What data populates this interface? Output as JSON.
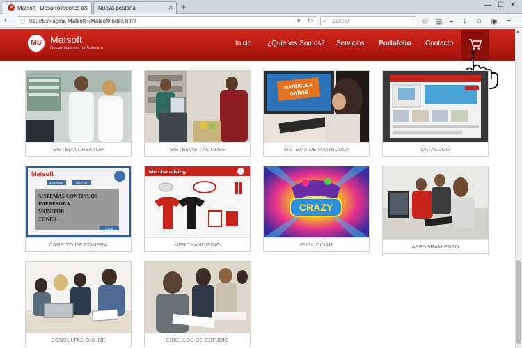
{
  "browser": {
    "active_tab": "Matsoft | Desarrolladores d...",
    "inactive_tab": "Nueva pestaña",
    "url": "file:///E:/Pagina Matsoft~/Matsoft/index.html",
    "search_placeholder": "Buscar"
  },
  "site": {
    "logo_text": "MS",
    "brand": "Matsoft",
    "tagline": "Desarrolladores de Software",
    "menu": [
      "Inicio",
      "¿Quienes Somos?",
      "Servicios",
      "Portafolio",
      "Contacto"
    ]
  },
  "portfolio": [
    {
      "caption": "SISTEMA DESKTOP"
    },
    {
      "caption": "SISTEMAS TÁCTILES"
    },
    {
      "caption": "SISTEMA DE MATRICULA"
    },
    {
      "caption": "CATALOGO"
    },
    {
      "caption": "CARRITO DE COMPRA"
    },
    {
      "caption": "MERCHANDISING"
    },
    {
      "caption": "PUBLICIDAD"
    },
    {
      "caption": "ASESORAMIENTO"
    },
    {
      "caption": "CONSULTAS ONLINE"
    },
    {
      "caption": "CIRCULOS DE ESTUDIO"
    }
  ],
  "thumb_text": {
    "matricula": [
      "MATRÍCULA",
      "online"
    ],
    "cart_brand": "Matsoft",
    "cart_buttons": [
      "AGREGAR",
      "ANULAR"
    ],
    "cart_lines": [
      "SISTEMAS CONTINUOS",
      "IMPRESORA",
      "MONITOR",
      "TONER"
    ],
    "cart_total": "TOTAL",
    "merch_title": "Merchandising",
    "publicidad": "CRAZY"
  },
  "colors": {
    "brand_red": "#c8241c",
    "header_dark": "#a3150d"
  }
}
